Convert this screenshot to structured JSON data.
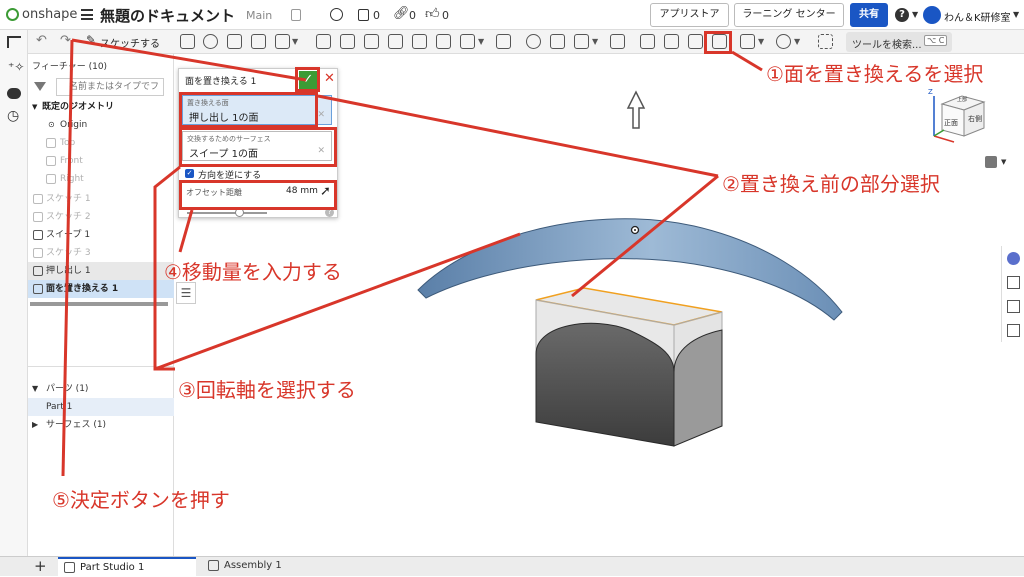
{
  "app": {
    "logo_text": "onshape",
    "doc_title": "無題のドキュメント",
    "branch": "Main",
    "count_versions": "0",
    "count_links": "0",
    "count_likes": "0",
    "app_store": "アプリストア",
    "learning_center": "ラーニング センター",
    "share": "共有",
    "user_name": "わん＆K研修室"
  },
  "toolbar": {
    "sketch_label": "スケッチする",
    "search_label": "ツールを検索...",
    "shortcut_label": "⌥ C"
  },
  "features": {
    "header": "フィーチャー (10)",
    "filter_placeholder": "名前またはタイプでフ",
    "items": [
      {
        "label": "既定のジオメトリ"
      },
      {
        "label": "Origin"
      },
      {
        "label": "Top"
      },
      {
        "label": "Front"
      },
      {
        "label": "Right"
      },
      {
        "label": "スケッチ 1"
      },
      {
        "label": "スケッチ 2"
      },
      {
        "label": "スイープ 1"
      },
      {
        "label": "スケッチ 3"
      },
      {
        "label": "押し出し 1"
      },
      {
        "label": "面を置き換える 1"
      }
    ],
    "parts_header": "パーツ (1)",
    "part_item": "Part 1",
    "surfaces_header": "サーフェス (1)"
  },
  "dialog": {
    "title": "面を置き換える 1",
    "field1_label": "置き換える面",
    "field1_value": "押し出し 1の面",
    "field2_label": "交換するためのサーフェス",
    "field2_value": "スイープ 1の面",
    "flip_label": "方向を逆にする",
    "offset_label": "オフセット距離",
    "offset_value": "48 mm"
  },
  "viewcube": {
    "top": "上部",
    "front": "正面",
    "right": "右側"
  },
  "annotations": {
    "a1": "①面を置き換えるを選択",
    "a2": "②置き換え前の部分選択",
    "a3": "③回転軸を選択する",
    "a4": "④移動量を入力する",
    "a5": "⑤決定ボタンを押す"
  },
  "tabs": {
    "tab1": "Part Studio 1",
    "tab2": "Assembly 1"
  },
  "colors": {
    "accent_blue": "#1a56c4",
    "annotation_red": "#d8362a",
    "confirm_green": "#3c9b35",
    "surface_blue": "#7a9cc0",
    "selection_orange": "#f0a020"
  }
}
